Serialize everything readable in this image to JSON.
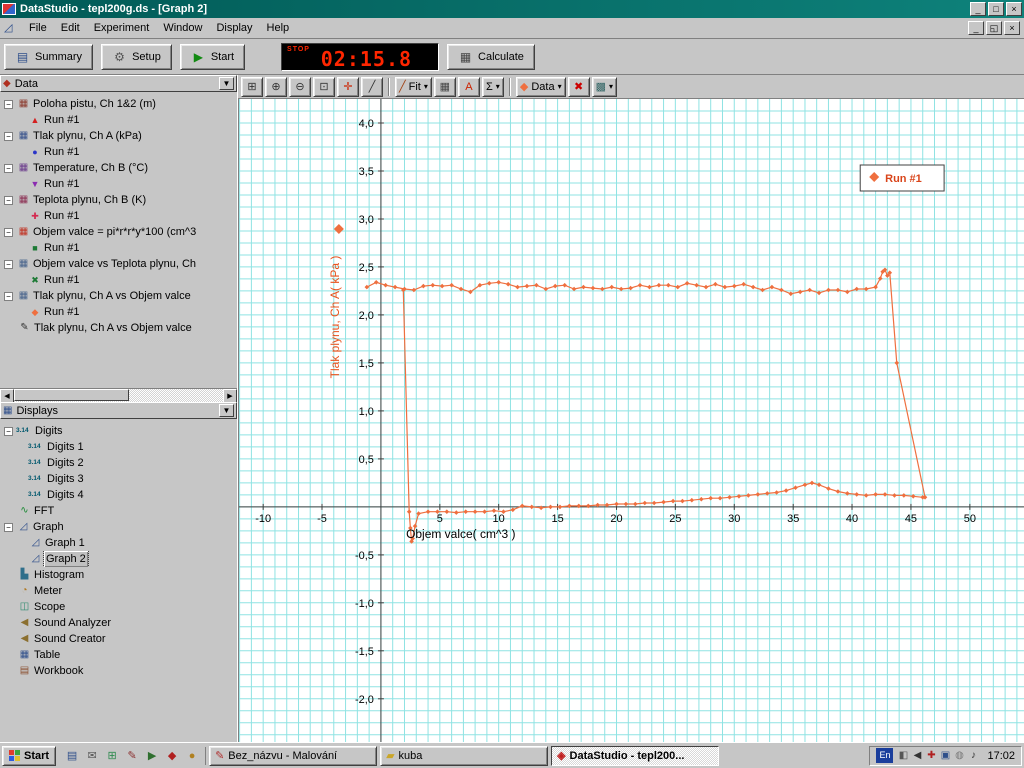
{
  "window": {
    "title": "DataStudio - tepl200g.ds - [Graph 2]",
    "controls": {
      "minimize": "_",
      "maximize": "□",
      "close": "×"
    }
  },
  "menubar": {
    "items": [
      "File",
      "Edit",
      "Experiment",
      "Window",
      "Display",
      "Help"
    ],
    "mdi_controls": {
      "minimize": "_",
      "restore": "◱",
      "close": "×"
    },
    "doc_icon": "◿"
  },
  "toolbar": {
    "summary": {
      "label": "Summary",
      "icon": "▤"
    },
    "setup": {
      "label": "Setup",
      "icon": "⚙"
    },
    "start": {
      "label": "Start",
      "icon": "▶"
    },
    "calculate": {
      "label": "Calculate",
      "icon": "▦"
    },
    "timer": {
      "stop": "STOP",
      "time": "02:15.8"
    }
  },
  "graph_toolbar": {
    "buttons": [
      {
        "name": "scale-to-fit-button",
        "glyph": "⊞",
        "color": "#333333"
      },
      {
        "name": "zoom-in-button",
        "glyph": "⊕",
        "color": "#333333"
      },
      {
        "name": "zoom-out-button",
        "glyph": "⊖",
        "color": "#333333"
      },
      {
        "name": "zoom-select-button",
        "glyph": "⊡",
        "color": "#333333"
      },
      {
        "name": "smart-tool-button",
        "glyph": "✛",
        "color": "#cc2200"
      },
      {
        "name": "slope-tool-button",
        "glyph": "╱",
        "color": "#333333"
      },
      {
        "type": "sep"
      },
      {
        "name": "fit-menu-button",
        "glyph": "╱",
        "color": "#a04010",
        "label": "Fit",
        "dropdown": true
      },
      {
        "name": "calculator-button",
        "glyph": "▦",
        "color": "#444444"
      },
      {
        "name": "text-annotation-button",
        "glyph": "A",
        "color": "#cc2200"
      },
      {
        "name": "statistics-button",
        "glyph": "Σ",
        "color": "#000000",
        "dropdown": true
      },
      {
        "type": "sep"
      },
      {
        "name": "data-menu-button",
        "glyph": "◆",
        "color": "#ef6f3f",
        "label": "Data",
        "dropdown": true
      },
      {
        "name": "remove-button",
        "glyph": "✖",
        "color": "#cc0000"
      },
      {
        "name": "graph-settings-button",
        "glyph": "▩",
        "color": "#336666",
        "dropdown": true
      }
    ]
  },
  "data_panel": {
    "header": "Data",
    "header_icon": "◆",
    "dropdown_icon": "▼",
    "items": [
      {
        "kind": "source",
        "label": "Poloha pistu, Ch 1&2 (m)",
        "icon_glyph": "▦",
        "icon_color": "#8b3a2e"
      },
      {
        "kind": "run",
        "label": "Run #1",
        "marker": "▲",
        "marker_color": "#d42020"
      },
      {
        "kind": "source",
        "label": "Tlak plynu, Ch A (kPa)",
        "icon_glyph": "▦",
        "icon_color": "#35508b"
      },
      {
        "kind": "run",
        "label": "Run #1",
        "marker": "●",
        "marker_color": "#2b35c8"
      },
      {
        "kind": "source",
        "label": "Temperature, Ch B (°C)",
        "icon_glyph": "▦",
        "icon_color": "#6a3a8b"
      },
      {
        "kind": "run",
        "label": "Run #1",
        "marker": "▼",
        "marker_color": "#8b2bb0"
      },
      {
        "kind": "source",
        "label": "Teplota plynu, Ch B (K)",
        "icon_glyph": "▦",
        "icon_color": "#8b2e52"
      },
      {
        "kind": "run",
        "label": "Run #1",
        "marker": "✚",
        "marker_color": "#d42a50"
      },
      {
        "kind": "source",
        "label": "Objem valce = pi*r*r*y*100 (cm^3",
        "icon_glyph": "▦",
        "icon_color": "#c03020"
      },
      {
        "kind": "run",
        "label": "Run #1",
        "marker": "■",
        "marker_color": "#1d7a35"
      },
      {
        "kind": "source",
        "label": "Objem valce vs Teplota plynu, Ch",
        "icon_glyph": "▦",
        "icon_color": "#46628b"
      },
      {
        "kind": "run",
        "label": "Run #1",
        "marker": "✖",
        "marker_color": "#1d7a35"
      },
      {
        "kind": "source",
        "label": "Tlak plynu, Ch A vs Objem valce",
        "icon_glyph": "▦",
        "icon_color": "#46628b"
      },
      {
        "kind": "run",
        "label": "Run #1",
        "marker": "◆",
        "marker_color": "#ef6f3f"
      },
      {
        "kind": "item",
        "label": "Tlak plynu, Ch A vs Objem valce",
        "icon_glyph": "✎",
        "icon_color": "#333333"
      }
    ]
  },
  "displays_panel": {
    "header": "Displays",
    "header_icon": "▦",
    "dropdown_icon": "▼",
    "items": [
      {
        "kind": "parent",
        "label": "Digits",
        "icon_text": "3.14"
      },
      {
        "kind": "child",
        "label": "Digits 1",
        "icon_text": "3.14"
      },
      {
        "kind": "child",
        "label": "Digits 2",
        "icon_text": "3.14"
      },
      {
        "kind": "child",
        "label": "Digits 3",
        "icon_text": "3.14"
      },
      {
        "kind": "child",
        "label": "Digits 4",
        "icon_text": "3.14"
      },
      {
        "kind": "item",
        "label": "FFT",
        "icon_glyph": "∿",
        "icon_color": "#1d8a35"
      },
      {
        "kind": "parent",
        "label": "Graph",
        "icon_glyph": "◿",
        "icon_color": "#2f4f8b"
      },
      {
        "kind": "child",
        "label": "Graph 1",
        "icon_glyph": "◿",
        "icon_color": "#2f4f8b"
      },
      {
        "kind": "child",
        "label": "Graph 2",
        "icon_glyph": "◿",
        "icon_color": "#2f4f8b",
        "selected": true
      },
      {
        "kind": "item",
        "label": "Histogram",
        "icon_glyph": "▙",
        "icon_color": "#2f6f8b"
      },
      {
        "kind": "item",
        "label": "Meter",
        "icon_glyph": "◔",
        "icon_color": "#b07820"
      },
      {
        "kind": "item",
        "label": "Scope",
        "icon_glyph": "◫",
        "icon_color": "#2f8b6f"
      },
      {
        "kind": "item",
        "label": "Sound Analyzer",
        "icon_glyph": "◀",
        "icon_color": "#8b6f2f"
      },
      {
        "kind": "item",
        "label": "Sound Creator",
        "icon_glyph": "◀",
        "icon_color": "#8b6f2f"
      },
      {
        "kind": "item",
        "label": "Table",
        "icon_glyph": "▦",
        "icon_color": "#2f4f8b"
      },
      {
        "kind": "item",
        "label": "Workbook",
        "icon_glyph": "▤",
        "icon_color": "#8b4f2f"
      }
    ]
  },
  "chart_data": {
    "type": "line",
    "title": "",
    "xlabel": "Objem valce( cm^3 )",
    "ylabel": "Tlak plynu, Ch A( kPa )",
    "xlim": [
      -12.05,
      54.6
    ],
    "ylim": [
      -2.45,
      4.25
    ],
    "grid": true,
    "grid_step_x": 1,
    "grid_step_y": 0.125,
    "grid_color": "#8fe3e3",
    "axis_color": "#404040",
    "x_ticks": [
      {
        "v": -10,
        "label": "-10"
      },
      {
        "v": -5,
        "label": "-5"
      },
      {
        "v": 5,
        "label": "5"
      },
      {
        "v": 10,
        "label": "10"
      },
      {
        "v": 15,
        "label": "15"
      },
      {
        "v": 20,
        "label": "20"
      },
      {
        "v": 25,
        "label": "25"
      },
      {
        "v": 30,
        "label": "30"
      },
      {
        "v": 35,
        "label": "35"
      },
      {
        "v": 40,
        "label": "40"
      },
      {
        "v": 45,
        "label": "45"
      },
      {
        "v": 50,
        "label": "50"
      }
    ],
    "y_ticks": [
      {
        "v": 4.0,
        "label": "4,0"
      },
      {
        "v": 3.5,
        "label": "3,5"
      },
      {
        "v": 3.0,
        "label": "3,0"
      },
      {
        "v": 2.5,
        "label": "2,5"
      },
      {
        "v": 2.0,
        "label": "2,0"
      },
      {
        "v": 1.5,
        "label": "1,5"
      },
      {
        "v": 1.0,
        "label": "1,0"
      },
      {
        "v": 0.5,
        "label": "0,5"
      },
      {
        "v": -0.5,
        "label": "-0,5"
      },
      {
        "v": -1.0,
        "label": "-1,0"
      },
      {
        "v": -1.5,
        "label": "-1,5"
      },
      {
        "v": -2.0,
        "label": "-2,0"
      }
    ],
    "legend": {
      "label": "Run #1",
      "color": "#d9441a",
      "position": "top-right"
    },
    "series": [
      {
        "name": "Run #1",
        "color": "#ef6f3f",
        "marker": "diamond",
        "points": [
          [
            -1.2,
            2.29
          ],
          [
            -0.4,
            2.34
          ],
          [
            0.4,
            2.31
          ],
          [
            1.2,
            2.29
          ],
          [
            2,
            2.27
          ],
          [
            2.8,
            2.26
          ],
          [
            3.6,
            2.3
          ],
          [
            4.4,
            2.31
          ],
          [
            5.2,
            2.3
          ],
          [
            6,
            2.31
          ],
          [
            6.8,
            2.27
          ],
          [
            7.6,
            2.24
          ],
          [
            8.4,
            2.31
          ],
          [
            9.2,
            2.33
          ],
          [
            10,
            2.34
          ],
          [
            10.8,
            2.32
          ],
          [
            11.6,
            2.29
          ],
          [
            12.4,
            2.3
          ],
          [
            13.2,
            2.31
          ],
          [
            14,
            2.27
          ],
          [
            14.8,
            2.3
          ],
          [
            15.6,
            2.31
          ],
          [
            16.4,
            2.27
          ],
          [
            17.2,
            2.29
          ],
          [
            18,
            2.28
          ],
          [
            18.8,
            2.27
          ],
          [
            19.6,
            2.29
          ],
          [
            20.4,
            2.27
          ],
          [
            21.2,
            2.28
          ],
          [
            22,
            2.31
          ],
          [
            22.8,
            2.29
          ],
          [
            23.6,
            2.31
          ],
          [
            24.4,
            2.31
          ],
          [
            25.2,
            2.29
          ],
          [
            26,
            2.33
          ],
          [
            26.8,
            2.31
          ],
          [
            27.6,
            2.29
          ],
          [
            28.4,
            2.32
          ],
          [
            29.2,
            2.29
          ],
          [
            30,
            2.3
          ],
          [
            30.8,
            2.32
          ],
          [
            31.6,
            2.29
          ],
          [
            32.4,
            2.26
          ],
          [
            33.2,
            2.29
          ],
          [
            34,
            2.26
          ],
          [
            34.8,
            2.22
          ],
          [
            35.6,
            2.24
          ],
          [
            36.4,
            2.26
          ],
          [
            37.2,
            2.23
          ],
          [
            38,
            2.26
          ],
          [
            38.8,
            2.26
          ],
          [
            39.6,
            2.24
          ],
          [
            40.4,
            2.27
          ],
          [
            41.2,
            2.27
          ],
          [
            42,
            2.29
          ],
          [
            42.4,
            2.38
          ],
          [
            42.6,
            2.45
          ],
          [
            42.8,
            2.47
          ],
          [
            43,
            2.41
          ],
          [
            43.2,
            2.44
          ],
          [
            43.8,
            1.5
          ],
          [
            46.2,
            0.1
          ],
          [
            46,
            0.1
          ],
          [
            45.2,
            0.11
          ],
          [
            44.4,
            0.12
          ],
          [
            43.6,
            0.12
          ],
          [
            42.8,
            0.13
          ],
          [
            42,
            0.13
          ],
          [
            41.2,
            0.12
          ],
          [
            40.4,
            0.13
          ],
          [
            39.6,
            0.14
          ],
          [
            38.8,
            0.16
          ],
          [
            38,
            0.19
          ],
          [
            37.2,
            0.23
          ],
          [
            36.6,
            0.25
          ],
          [
            36,
            0.23
          ],
          [
            35.2,
            0.2
          ],
          [
            34.4,
            0.17
          ],
          [
            33.6,
            0.15
          ],
          [
            32.8,
            0.14
          ],
          [
            32,
            0.13
          ],
          [
            31.2,
            0.12
          ],
          [
            30.4,
            0.11
          ],
          [
            29.6,
            0.1
          ],
          [
            28.8,
            0.09
          ],
          [
            28,
            0.09
          ],
          [
            27.2,
            0.08
          ],
          [
            26.4,
            0.07
          ],
          [
            25.6,
            0.06
          ],
          [
            24.8,
            0.06
          ],
          [
            24,
            0.05
          ],
          [
            23.2,
            0.04
          ],
          [
            22.4,
            0.04
          ],
          [
            21.6,
            0.03
          ],
          [
            20.8,
            0.03
          ],
          [
            20,
            0.03
          ],
          [
            19.2,
            0.02
          ],
          [
            18.4,
            0.02
          ],
          [
            17.6,
            0.01
          ],
          [
            16.8,
            0.01
          ],
          [
            16,
            0.01
          ],
          [
            15.2,
            0
          ],
          [
            14.4,
            0
          ],
          [
            13.6,
            -0.01
          ],
          [
            12.8,
            0
          ],
          [
            12,
            0.01
          ],
          [
            11.2,
            -0.03
          ],
          [
            10.4,
            -0.05
          ],
          [
            9.6,
            -0.04
          ],
          [
            8.8,
            -0.05
          ],
          [
            8,
            -0.05
          ],
          [
            7.2,
            -0.05
          ],
          [
            6.4,
            -0.06
          ],
          [
            5.6,
            -0.05
          ],
          [
            4.8,
            -0.05
          ],
          [
            4,
            -0.05
          ],
          [
            3.2,
            -0.07
          ],
          [
            2.9,
            -0.2
          ],
          [
            2.7,
            -0.33
          ],
          [
            2.6,
            -0.36
          ],
          [
            2.5,
            -0.22
          ],
          [
            2.4,
            -0.05
          ],
          [
            1.9,
            2.26
          ]
        ]
      }
    ]
  },
  "taskbar": {
    "start": "Start",
    "quick_launch": [
      {
        "name": "quick-launch-desktop-icon",
        "glyph": "▤",
        "color": "#2f4f8b"
      },
      {
        "name": "quick-launch-mail-icon",
        "glyph": "✉",
        "color": "#555555"
      },
      {
        "name": "quick-launch-browser-icon",
        "glyph": "⊞",
        "color": "#2f8b4f"
      },
      {
        "name": "quick-launch-paint-icon",
        "glyph": "✎",
        "color": "#8b2f2f"
      },
      {
        "name": "quick-launch-media-icon",
        "glyph": "▶",
        "color": "#2f6f2f"
      },
      {
        "name": "quick-launch-app1-icon",
        "glyph": "◆",
        "color": "#b02020"
      },
      {
        "name": "quick-launch-app2-icon",
        "glyph": "●",
        "color": "#b08020"
      }
    ],
    "tasks": [
      {
        "label": "Bez_názvu - Malování",
        "glyph": "✎",
        "color": "#b03030",
        "active": false
      },
      {
        "label": "kuba",
        "glyph": "▰",
        "color": "#caa62a",
        "active": false
      },
      {
        "label": "DataStudio - tepl200...",
        "glyph": "◈",
        "color": "#c02020",
        "active": true
      }
    ],
    "tray": {
      "keyboard": "En",
      "icons": [
        {
          "name": "tray-display-icon",
          "glyph": "◧",
          "color": "#555555"
        },
        {
          "name": "tray-volume-icon",
          "glyph": "◀",
          "color": "#333333"
        },
        {
          "name": "tray-antivirus-icon",
          "glyph": "✚",
          "color": "#b02020"
        },
        {
          "name": "tray-network-icon",
          "glyph": "▣",
          "color": "#2f4f8b"
        },
        {
          "name": "tray-scheduler-icon",
          "glyph": "◍",
          "color": "#777777"
        },
        {
          "name": "tray-sound-icon",
          "glyph": "♪",
          "color": "#333333"
        }
      ],
      "clock": "17:02"
    }
  }
}
